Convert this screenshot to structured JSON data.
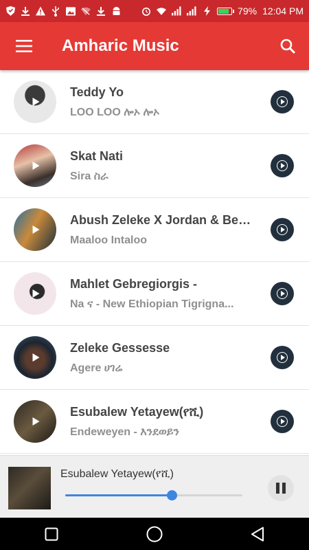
{
  "status_bar": {
    "battery_text": "79%",
    "time": "12:04 PM",
    "icons_left": [
      "shield-icon",
      "download-icon",
      "warning-icon",
      "usb-icon",
      "image-icon",
      "wifi-off-icon",
      "download-icon",
      "android-icon"
    ],
    "icons_right": [
      "alarm-icon",
      "wifi-icon",
      "signal-icon",
      "signal-icon",
      "charging-icon",
      "battery-icon"
    ]
  },
  "app_bar": {
    "title": "Amharic Music",
    "menu_icon": "menu-icon",
    "search_icon": "search-icon",
    "color": "#e53935"
  },
  "songs": [
    {
      "title": "Teddy Yo",
      "subtitle": "LOO LOO  ሎኦ ሎኦ"
    },
    {
      "title": "Skat Nati",
      "subtitle": "Sira  ስራ"
    },
    {
      "title": "Abush Zeleke X Jordan & Bek...",
      "subtitle": "Maaloo Intaloo"
    },
    {
      "title": "Mahlet Gebregiorgis -",
      "subtitle": " Na  ና - New Ethiopian Tigrigna..."
    },
    {
      "title": "Zeleke Gessesse",
      "subtitle": "Agere ሀገሬ"
    },
    {
      "title": "Esubalew Yetayew(የሺ)",
      "subtitle": "Endeweyen - እንደወይን"
    }
  ],
  "player": {
    "now_playing": "Esubalew Yetayew(የሺ)",
    "progress": 0.6,
    "accent": "#3d86e0"
  },
  "nav_bar": {
    "icons": [
      "recents-icon",
      "home-icon",
      "back-icon"
    ]
  }
}
